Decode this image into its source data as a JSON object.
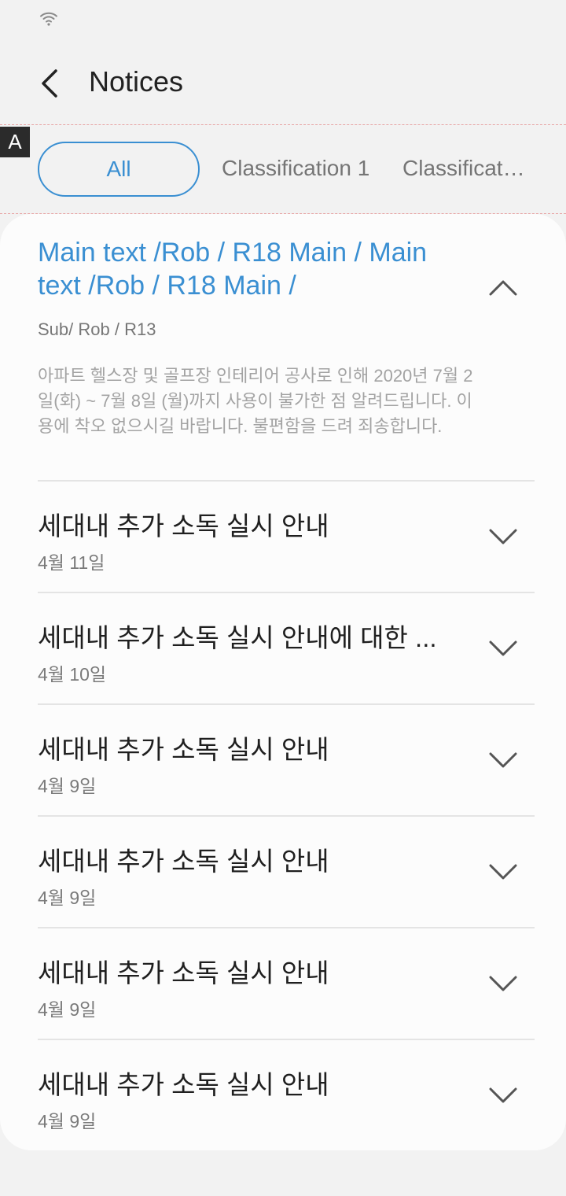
{
  "app_bar": {
    "title": "Notices"
  },
  "annotation_marker": "A",
  "filters": {
    "all_label": "All",
    "chips": [
      "Classification 1",
      "Classificat…"
    ]
  },
  "expanded_notice": {
    "title": "Main text /Rob / R18 Main / Main text /Rob / R18 Main /",
    "subtitle": "Sub/ Rob / R13",
    "body": "아파트 헬스장 및 골프장 인테리어 공사로 인해 2020년 7월 2일(화) ~ 7월 8일 (월)까지 사용이 불가한 점 알려드립니다. 이용에 착오 없으시길 바랍니다. 불편함을 드려 죄송합니다."
  },
  "notices": [
    {
      "title": "세대내 추가 소독 실시 안내",
      "date": "4월 11일"
    },
    {
      "title": "세대내 추가 소독 실시 안내에 대한 ...",
      "date": "4월 10일"
    },
    {
      "title": "세대내 추가 소독 실시 안내",
      "date": "4월 9일"
    },
    {
      "title": "세대내 추가 소독 실시 안내",
      "date": "4월 9일"
    },
    {
      "title": "세대내 추가 소독 실시 안내",
      "date": "4월 9일"
    },
    {
      "title": "세대내 추가 소독 실시 안내",
      "date": "4월 9일"
    }
  ],
  "colors": {
    "accent": "#3a8fd2",
    "background": "#f2f2f2",
    "card": "#fcfcfc"
  }
}
